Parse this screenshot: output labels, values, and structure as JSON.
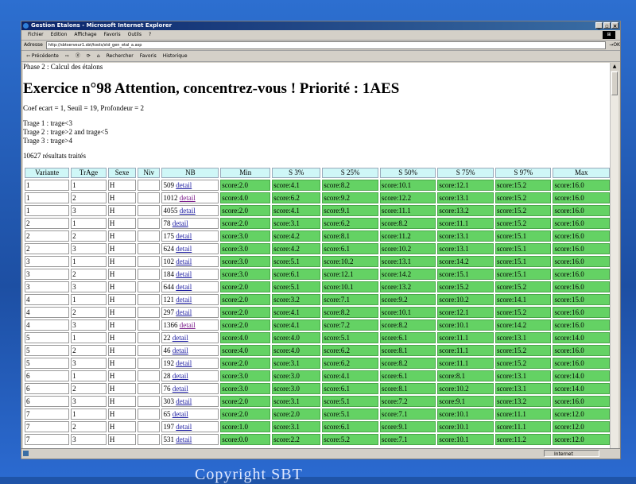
{
  "window": {
    "title": "Gestion Etalons - Microsoft Internet Explorer",
    "controls": [
      "_",
      "▫",
      "×"
    ]
  },
  "menu": [
    "Fichier",
    "Edition",
    "Affichage",
    "Favoris",
    "Outils",
    "?"
  ],
  "address": {
    "label": "Adresse",
    "url": "http://sbtserveur1.sbt/tools/std_gen_etal_a.asp",
    "go": "OK"
  },
  "toolbar": [
    "⇦ Précédente",
    "⇨",
    "Ⓧ",
    "⟳",
    "⌂",
    "Rechercher",
    "Favoris",
    "Historique"
  ],
  "desktop_text": "Copyright SBT",
  "status": {
    "zone": "Internet"
  },
  "page": {
    "phase": "Phase 2 : Calcul des étalons",
    "heading": "Exercice n°98 Attention, concentrez-vous ! Priorité : 1AES",
    "params": "Coef ecart = 1, Seuil = 19, Profondeur = 2",
    "trages": [
      "Trage 1 : trage<3",
      "Trage 2 : trage>2 and trage<5",
      "Trage 3 : trage>4"
    ],
    "results": "10627 résultats traités"
  },
  "table": {
    "headers": [
      "Variante",
      "TrAge",
      "Sexe",
      "Niv",
      "NB",
      "Min",
      "S 3%",
      "S 25%",
      "S 50%",
      "S 75%",
      "S 97%",
      "Max"
    ],
    "rows": [
      [
        "1",
        "1",
        "H",
        "",
        "509",
        "detail",
        "score:2.0",
        "score:4.1",
        "score:8.2",
        "score:10.1",
        "score:12.1",
        "score:15.2",
        "score:16.0"
      ],
      [
        "1",
        "2",
        "H",
        "",
        "1012",
        "detail",
        "score:4.0",
        "score:6.2",
        "score:9.2",
        "score:12.2",
        "score:13.1",
        "score:15.2",
        "score:16.0"
      ],
      [
        "1",
        "3",
        "H",
        "",
        "4055",
        "detail",
        "score:2.0",
        "score:4.1",
        "score:9.1",
        "score:11.1",
        "score:13.2",
        "score:15.2",
        "score:16.0"
      ],
      [
        "2",
        "1",
        "H",
        "",
        "78",
        "detail",
        "score:2.0",
        "score:3.1",
        "score:6.2",
        "score:8.2",
        "score:11.1",
        "score:15.2",
        "score:16.0"
      ],
      [
        "2",
        "2",
        "H",
        "",
        "175",
        "detail",
        "score:3.0",
        "score:4.2",
        "score:8.1",
        "score:11.2",
        "score:13.1",
        "score:15.1",
        "score:16.0"
      ],
      [
        "2",
        "3",
        "H",
        "",
        "624",
        "detail",
        "score:3.0",
        "score:4.2",
        "score:6.1",
        "score:10.2",
        "score:13.1",
        "score:15.1",
        "score:16.0"
      ],
      [
        "3",
        "1",
        "H",
        "",
        "102",
        "detail",
        "score:3.0",
        "score:5.1",
        "score:10.2",
        "score:13.1",
        "score:14.2",
        "score:15.1",
        "score:16.0"
      ],
      [
        "3",
        "2",
        "H",
        "",
        "184",
        "detail",
        "score:3.0",
        "score:6.1",
        "score:12.1",
        "score:14.2",
        "score:15.1",
        "score:15.1",
        "score:16.0"
      ],
      [
        "3",
        "3",
        "H",
        "",
        "644",
        "detail",
        "score:2.0",
        "score:5.1",
        "score:10.1",
        "score:13.2",
        "score:15.2",
        "score:15.2",
        "score:16.0"
      ],
      [
        "4",
        "1",
        "H",
        "",
        "121",
        "detail",
        "score:2.0",
        "score:3.2",
        "score:7.1",
        "score:9.2",
        "score:10.2",
        "score:14.1",
        "score:15.0"
      ],
      [
        "4",
        "2",
        "H",
        "",
        "297",
        "detail",
        "score:2.0",
        "score:4.1",
        "score:8.2",
        "score:10.1",
        "score:12.1",
        "score:15.2",
        "score:16.0"
      ],
      [
        "4",
        "3",
        "H",
        "",
        "1366",
        "detail",
        "score:2.0",
        "score:4.1",
        "score:7.2",
        "score:8.2",
        "score:10.1",
        "score:14.2",
        "score:16.0"
      ],
      [
        "5",
        "1",
        "H",
        "",
        "22",
        "detail",
        "score:4.0",
        "score:4.0",
        "score:5.1",
        "score:6.1",
        "score:11.1",
        "score:13.1",
        "score:14.0"
      ],
      [
        "5",
        "2",
        "H",
        "",
        "46",
        "detail",
        "score:4.0",
        "score:4.0",
        "score:6.2",
        "score:8.1",
        "score:11.1",
        "score:15.2",
        "score:16.0"
      ],
      [
        "5",
        "3",
        "H",
        "",
        "192",
        "detail",
        "score:2.0",
        "score:3.1",
        "score:6.2",
        "score:8.2",
        "score:11.1",
        "score:15.2",
        "score:16.0"
      ],
      [
        "6",
        "1",
        "H",
        "",
        "28",
        "detail",
        "score:3.0",
        "score:3.0",
        "score:4.1",
        "score:6.1",
        "score:8.1",
        "score:13.1",
        "score:14.0"
      ],
      [
        "6",
        "2",
        "H",
        "",
        "76",
        "detail",
        "score:3.0",
        "score:3.0",
        "score:6.1",
        "score:8.1",
        "score:10.2",
        "score:13.1",
        "score:14.0"
      ],
      [
        "6",
        "3",
        "H",
        "",
        "303",
        "detail",
        "score:2.0",
        "score:3.1",
        "score:5.1",
        "score:7.2",
        "score:9.1",
        "score:13.2",
        "score:16.0"
      ],
      [
        "7",
        "1",
        "H",
        "",
        "65",
        "detail",
        "score:2.0",
        "score:2.0",
        "score:5.1",
        "score:7.1",
        "score:10.1",
        "score:11.1",
        "score:12.0"
      ],
      [
        "7",
        "2",
        "H",
        "",
        "197",
        "detail",
        "score:1.0",
        "score:3.1",
        "score:6.1",
        "score:9.1",
        "score:10.1",
        "score:11.1",
        "score:12.0"
      ],
      [
        "7",
        "3",
        "H",
        "",
        "531",
        "detail",
        "score:0.0",
        "score:2.2",
        "score:5.2",
        "score:7.1",
        "score:10.1",
        "score:11.2",
        "score:12.0"
      ]
    ]
  }
}
